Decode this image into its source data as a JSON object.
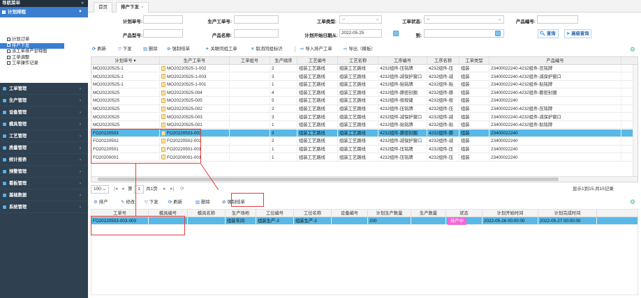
{
  "sidebar": {
    "title": "导航菜单",
    "collapse_icon": "double-chevron-left-icon",
    "plan_label": "计划排程",
    "sub_items": [
      {
        "label": "计划订单"
      },
      {
        "label": "排产下发"
      },
      {
        "label": "派工单排产甘特图"
      },
      {
        "label": "工单调整"
      },
      {
        "label": "工单操作记录"
      }
    ],
    "menus": [
      {
        "label": "工单管理"
      },
      {
        "label": "生产管理"
      },
      {
        "label": "设备管理"
      },
      {
        "label": "模具管理"
      },
      {
        "label": "工艺管理"
      },
      {
        "label": "质量管理"
      },
      {
        "label": "统计报表"
      },
      {
        "label": "预警管理"
      },
      {
        "label": "看板管理"
      },
      {
        "label": "基础数据"
      },
      {
        "label": "系统管理"
      }
    ]
  },
  "tabs": [
    {
      "label": "首页"
    },
    {
      "label": "排产下发",
      "close": "×"
    }
  ],
  "filters": {
    "plan_no_label": "计划单号:",
    "work_order_label": "生产工单号:",
    "work_type_label": "工单类型:",
    "work_type_value": "--",
    "work_status_label": "工单状态:",
    "work_status_value": "--",
    "product_code_label": "产品编号:",
    "product_model_label": "产品型号:",
    "product_name_label": "产品名称:",
    "plan_start_label": "计划开始日期从:",
    "plan_start_value": "2022-05-25",
    "to_label": "到:",
    "search_label": "查询",
    "advanced_label": "高级查询"
  },
  "toolbar": {
    "refresh": "刷新",
    "issue": "下发",
    "delete": "删除",
    "force_close": "强制结单",
    "link_work": "关联同组工单",
    "cancel_link": "取消同组标识",
    "import": "导入排产工单",
    "export": "导出（模板）"
  },
  "grid": {
    "columns": [
      "计划单号 ▾",
      "生产工单号",
      "工单组号",
      "生产顺序",
      "工艺编号",
      "工艺名称",
      "工序编号",
      "工序名称",
      "工单类型",
      "产品编号"
    ],
    "rows": [
      [
        "MO20220525-1",
        "MO20220525-1-002",
        "",
        "2",
        "组装工艺路线",
        "组装工艺路线",
        "4232组件-压铭牌",
        "4232组件-压",
        "组装",
        "23400022240-4232组件-压铭牌"
      ],
      [
        "MO20220525-1",
        "MO20220525-1-003",
        "",
        "3",
        "组装工艺路线",
        "组装工艺路线",
        "4232组件-减保护窗口",
        "4232组件-减",
        "组装",
        "23400022240-4232组件-减保护窗口"
      ],
      [
        "MO20220525-1",
        "MO20220525-1-001",
        "",
        "1",
        "组装工艺路线",
        "组装工艺路线",
        "4232组件-贴铭牌",
        "4232组件-贴",
        "组装",
        "23400022240-4232组件-贴铭牌"
      ],
      [
        "MO20220525",
        "MO20220525-004",
        "",
        "4",
        "组装工艺路线",
        "组装工艺路线",
        "4232组件-撕密封圈",
        "4232组件-撕",
        "组装",
        "23400022240-4232组件-撕密封圈"
      ],
      [
        "MO20220525",
        "MO20220525-005",
        "",
        "5",
        "组装工艺路线",
        "组装工艺路线",
        "4232组件-按按键",
        "4232组件-按",
        "组装",
        "23400022240"
      ],
      [
        "MO20220525",
        "MO20220525-002",
        "",
        "2",
        "组装工艺路线",
        "组装工艺路线",
        "4232组件-压铭牌",
        "4232组件-压",
        "组装",
        "23400022240-4232组件-压铭牌"
      ],
      [
        "MO20220525",
        "MO20220525-003",
        "",
        "3",
        "组装工艺路线",
        "组装工艺路线",
        "4232组件-减保护窗口",
        "4232组件-减",
        "组装",
        "23400022240-4232组件-减保护窗口"
      ],
      [
        "MO20220525",
        "MO20220525-001",
        "",
        "1",
        "组装工艺路线",
        "组装工艺路线",
        "4232组件-贴铭牌",
        "4232组件-贴",
        "组装",
        "23400022240-4232组件-贴铭牌"
      ],
      [
        "FO20220503",
        "FO20220503-003",
        "",
        "3",
        "组装工艺路线",
        "组装工艺路线",
        "4232组件-撕密封圈",
        "4232组件-撕",
        "组装",
        "23400022240"
      ],
      [
        "FO20220502",
        "FO20220502-002",
        "",
        "2",
        "组装工艺路线",
        "组装工艺路线",
        "4232组件-减保护窗口",
        "4232组件-减",
        "组装",
        "23400022240"
      ],
      [
        "FO20220501",
        "FO20220501-001",
        "",
        "1",
        "组装工艺路线",
        "组装工艺路线",
        "4232组件-压铭牌",
        "4232组件-压",
        "组装",
        "23400022240"
      ],
      [
        "FO20200001",
        "FO20200001-001",
        "",
        "1",
        "组装工艺路线",
        "组装工艺路线",
        "4232组件-压铭牌",
        "4232组件-压",
        "组装",
        "23400022240"
      ]
    ]
  },
  "pager": {
    "page_size": "100",
    "page_prefix": "第",
    "page_value": "1",
    "page_total": "共1页",
    "summary": "显示1到15,共15记录"
  },
  "toolbar2": {
    "schedule": "排产",
    "edit": "修改",
    "issue": "下发",
    "refresh": "刷新",
    "delete": "删除",
    "force_close": "强制结单"
  },
  "grid2": {
    "columns": [
      "工单号",
      "模具编号",
      "模具名称",
      "生产场地",
      "工位编号",
      "工位名称",
      "设备编号",
      "计划生产数量",
      "生产数量",
      "状态",
      "计划开始时间",
      "计划完成时间"
    ],
    "rows": [
      [
        "FO20220503-003-003",
        "",
        "",
        "组装车间",
        "组装生产-3",
        "组装生产-3",
        "",
        "200",
        "",
        "待产中",
        "2022-05-26 00:00:00",
        "2022-05-27 00:00:00"
      ]
    ]
  },
  "colors": {
    "sidebar": "#2f4050",
    "accent": "#3a7ed0",
    "selected_row": "#57b9e7",
    "annotation": "#e23b3b",
    "status_badge": "#f466d9"
  }
}
